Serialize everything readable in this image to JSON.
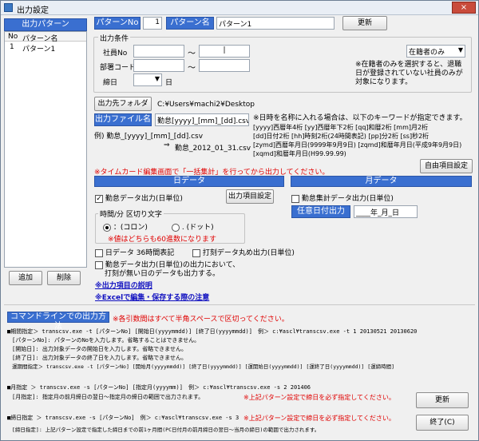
{
  "window": {
    "title": "出力設定",
    "close_glyph": "×"
  },
  "left_panel": {
    "header": "出力パターン",
    "col_no": "No",
    "col_name": "パターン名",
    "rows": [
      {
        "no": "1",
        "name": "パターン1"
      }
    ],
    "add_label": "追加",
    "delete_label": "削除"
  },
  "pattern": {
    "no_label": "パターンNo",
    "no_value": "1",
    "name_label": "パターン名",
    "name_value": "パターン1",
    "update_label": "更新"
  },
  "conditions": {
    "title": "出力条件",
    "employee_no_label": "社員No",
    "dept_code_label": "部署コード",
    "cutoff_label": "締日",
    "day_unit": "日",
    "tilde": "～",
    "employee_no_to_value": "|",
    "status_select": "在籍者のみ",
    "status_note": "※在籍者のみを選択すると、退職日が登録されていない社員のみが対象になります。"
  },
  "output": {
    "folder_button": "出力先フォルダ",
    "folder_path": "C:¥Users¥machi2¥Desktop",
    "file_label": "出力ファイル名",
    "file_value": "勤怠[yyyy]_[mm]_[dd].csv",
    "example_label": "例) 勤怠_[yyyy]_[mm]_[dd].csv",
    "example_arrow": "⇒",
    "example_result": "勤怠_2012_01_31.csv",
    "keyword_note_lines": [
      "※日時を名称に入れる場合は、以下のキーワードが指定できます。",
      "[yyyy]西暦年4桁 [yy]西暦年下2桁 [qq]和暦2桁 [mm]月2桁",
      "[dd]日付2桁 [hh]時刻2桁(24時間表記) [pp]分2桁 [ss]秒2桁",
      "[zymd]西暦年月日(9999年9月9日) [zqmd]和暦年月日(平成9年9月9日)",
      "[xqmd]和暦年月日(H99.99.99)"
    ],
    "batch_note": "※タイムカード編集画面で「一括集計」を行ってから出力してください。",
    "free_item_button": "自由項目設定"
  },
  "daily": {
    "header": "日データ",
    "attendance_checkbox": "勤怠データ出力(日単位)",
    "attendance_checked": true,
    "check_glyph": "✓",
    "item_settings_button": "出力項目設定",
    "time_separator_label": "時間/分 区切り文字",
    "colon_option": "：(コロン)",
    "dot_option": ". (ドット)",
    "sixty_note": "※値はどちらも60進数になります",
    "hour36_checkbox": "日データ 36時間表記",
    "stamp_round_checkbox": "打刻データ丸め出力(日単位)",
    "no_stamp_line1": "勤怠データ出力(日単位)の出力において、",
    "no_stamp_line2": "打刻が無い日のデータも出力する。",
    "link_items": "※出力項目の説明",
    "link_excel": "※Excelで編集・保存する際の注意"
  },
  "monthly": {
    "header": "月データ",
    "attendance_checkbox": "勤怠集計データ出力(日単位)",
    "date_label": "任意日付出力",
    "date_value": "____年_月_日"
  },
  "cmdline": {
    "header": "コマンドラインでの出力方法",
    "note": "※各引数間はすべて半角スペースで区切ってください。",
    "period_lines": [
      "■期間指定＞ transcsv.exe -t [パターンNo] [開始日(yyyymmdd)] [終了日(yyyymmdd)]　例＞ c:¥ascl¥transcsv.exe -t 1 20130521 20130620",
      "[パターンNo]: パターンのNoを入力します。省略することはできません。",
      "[開始日]: 出力対象データの開始日を入力します。省略できません。",
      "[終了日]: 出力対象データの終了日を入力します。省略できません。",
      "運期間指定＞ transcsv.exe -t [パターンNo] [開始月(yyyymmdd)] [終了日(yyyymmdd)] [運開始日(yyyymmdd)] [運終了日(yyyymmdd)] [運締時間]"
    ],
    "month_line1": "■月指定 ＞ transcsv.exe -s [パターンNo] [指定月(yyyymm)]　例＞ c:¥ascl¥transcsv.exe -s 2 201406",
    "month_line2": "[月指定]: 指定月の前月締日の翌日～指定月の締日の範囲で出力されます。",
    "month_warning": "※上記パターン設定で締日を必ず指定してください。",
    "cutoff_line1": "■締日指定 ＞ transcsv.exe -s [パターンNo]　例＞ c:¥ascl¥transcsv.exe -s 3",
    "cutoff_warning": "※上記パターン設定で締日を必ず指定してください。",
    "cutoff_line2": "[締日指定]: 上記パターン設定で指定した締日までの前1ヶ月間(PC日付月の前月締日の翌日～当月の締日)の範囲で出力されます。",
    "update_button": "更新",
    "exit_button": "終了(C)"
  }
}
